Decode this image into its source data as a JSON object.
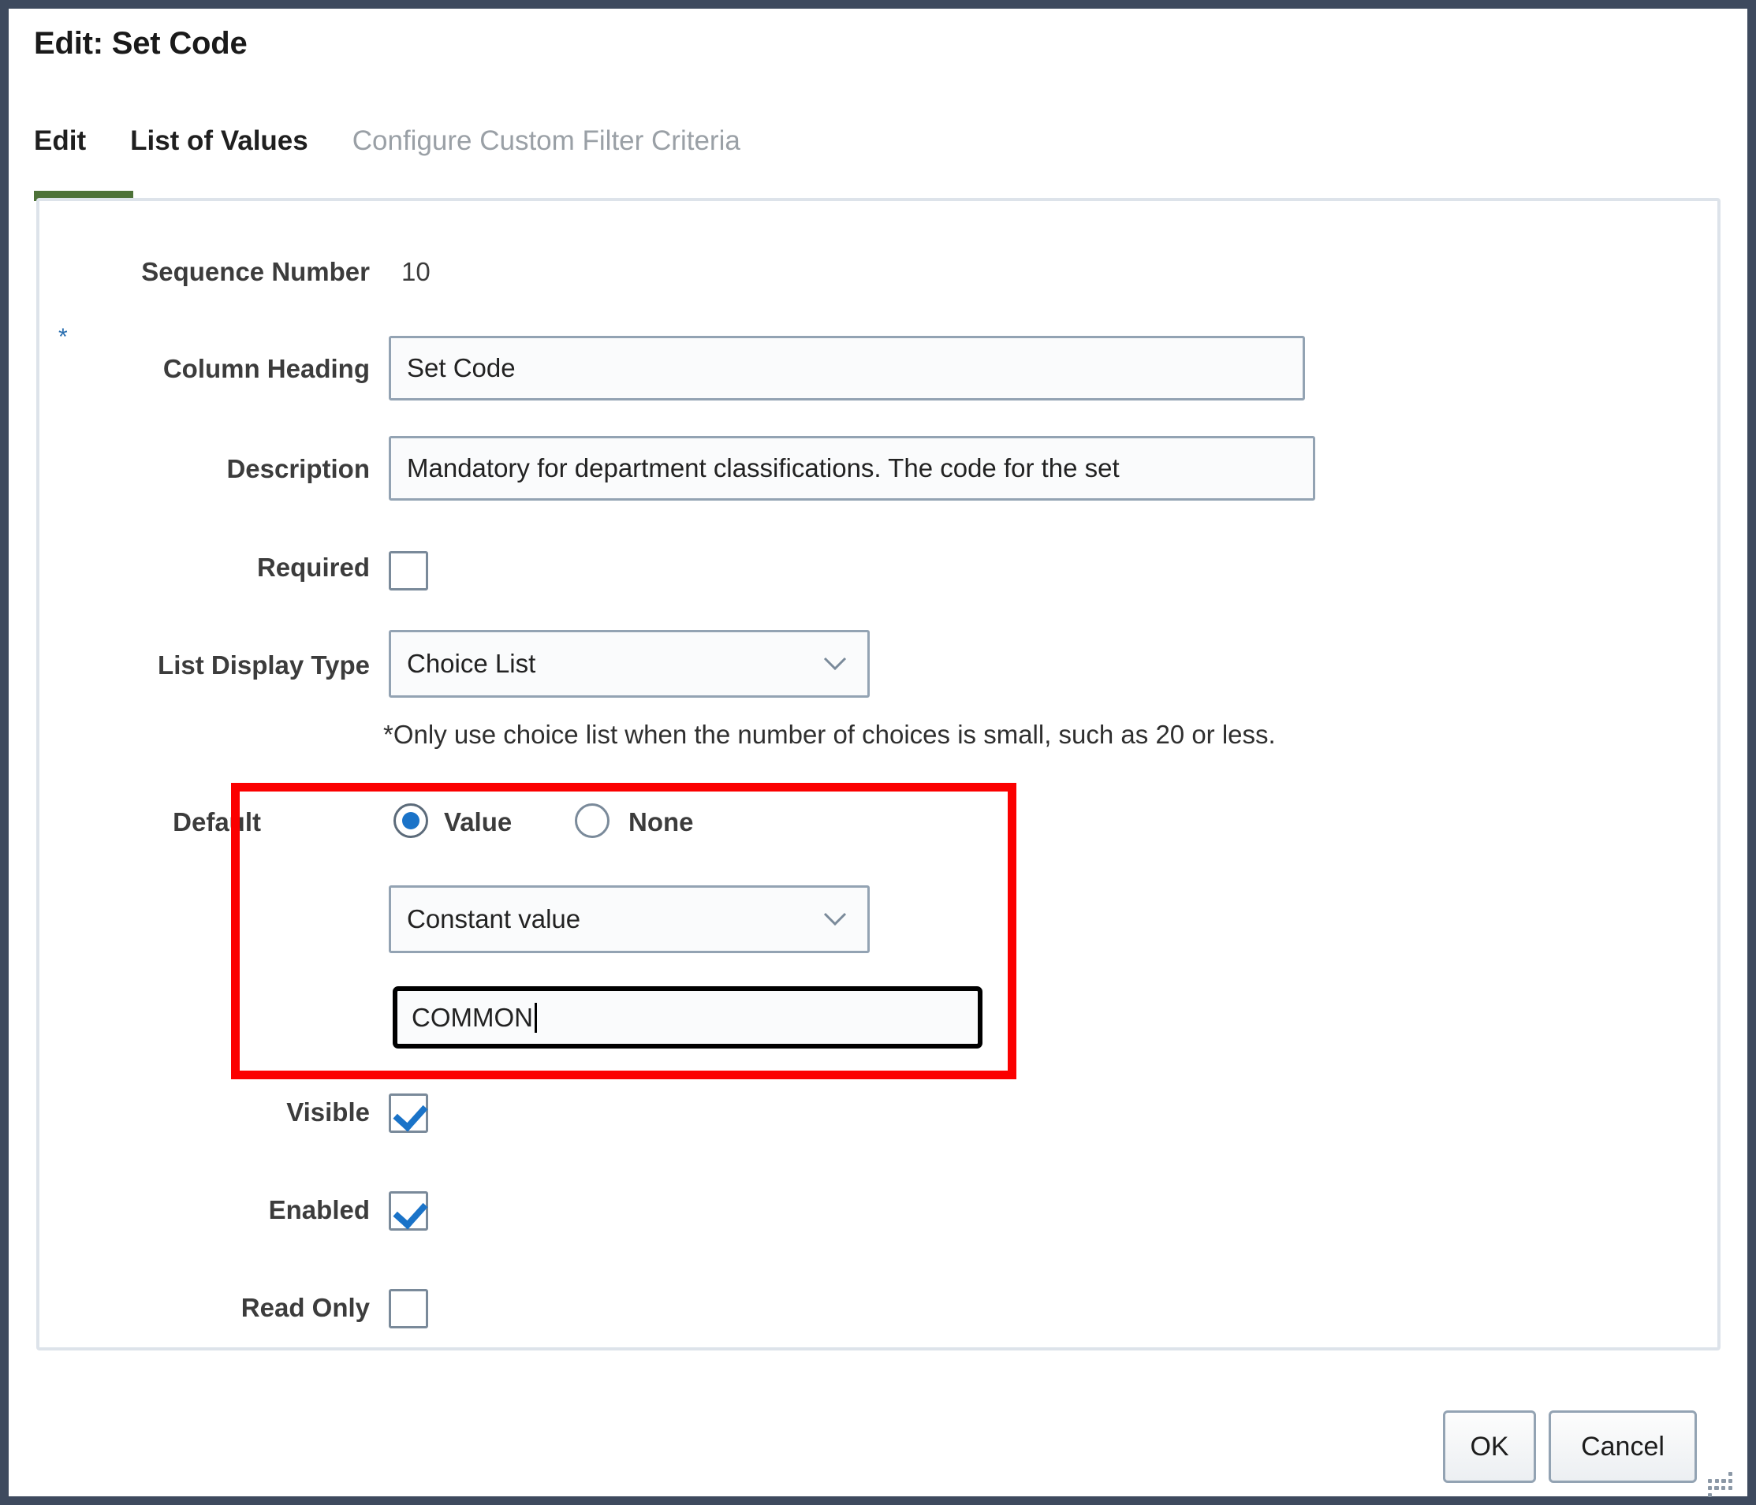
{
  "dialog": {
    "title": "Edit: Set Code"
  },
  "tabs": [
    {
      "label": "Edit",
      "state": "active"
    },
    {
      "label": "List of Values",
      "state": "enabled"
    },
    {
      "label": "Configure Custom Filter Criteria",
      "state": "disabled"
    }
  ],
  "form": {
    "sequence_number": {
      "label": "Sequence Number",
      "value": "10"
    },
    "column_heading": {
      "label": "Column Heading",
      "required_marker": "*",
      "value": "Set Code"
    },
    "description": {
      "label": "Description",
      "value": "Mandatory for department classifications. The code for the set"
    },
    "required": {
      "label": "Required",
      "checked": false
    },
    "list_display_type": {
      "label": "List Display Type",
      "value": "Choice List",
      "hint": "*Only use choice list when the number of choices is small, such as 20 or less."
    },
    "default": {
      "label": "Default",
      "radio_value_label": "Value",
      "radio_none_label": "None",
      "selected": "Value",
      "source_value": "Constant value",
      "constant_value": "COMMON"
    },
    "visible": {
      "label": "Visible",
      "checked": true
    },
    "enabled": {
      "label": "Enabled",
      "checked": true
    },
    "read_only": {
      "label": "Read Only",
      "checked": false
    }
  },
  "footer": {
    "ok_label": "OK",
    "cancel_label": "Cancel"
  },
  "colors": {
    "window_frame": "#3e4a5e",
    "active_tab_underline": "#4d7238",
    "highlight_box": "#fb0000",
    "accent_blue": "#1a73c8",
    "required_star": "#2a6fb0",
    "panel_border": "#dde3ea"
  }
}
